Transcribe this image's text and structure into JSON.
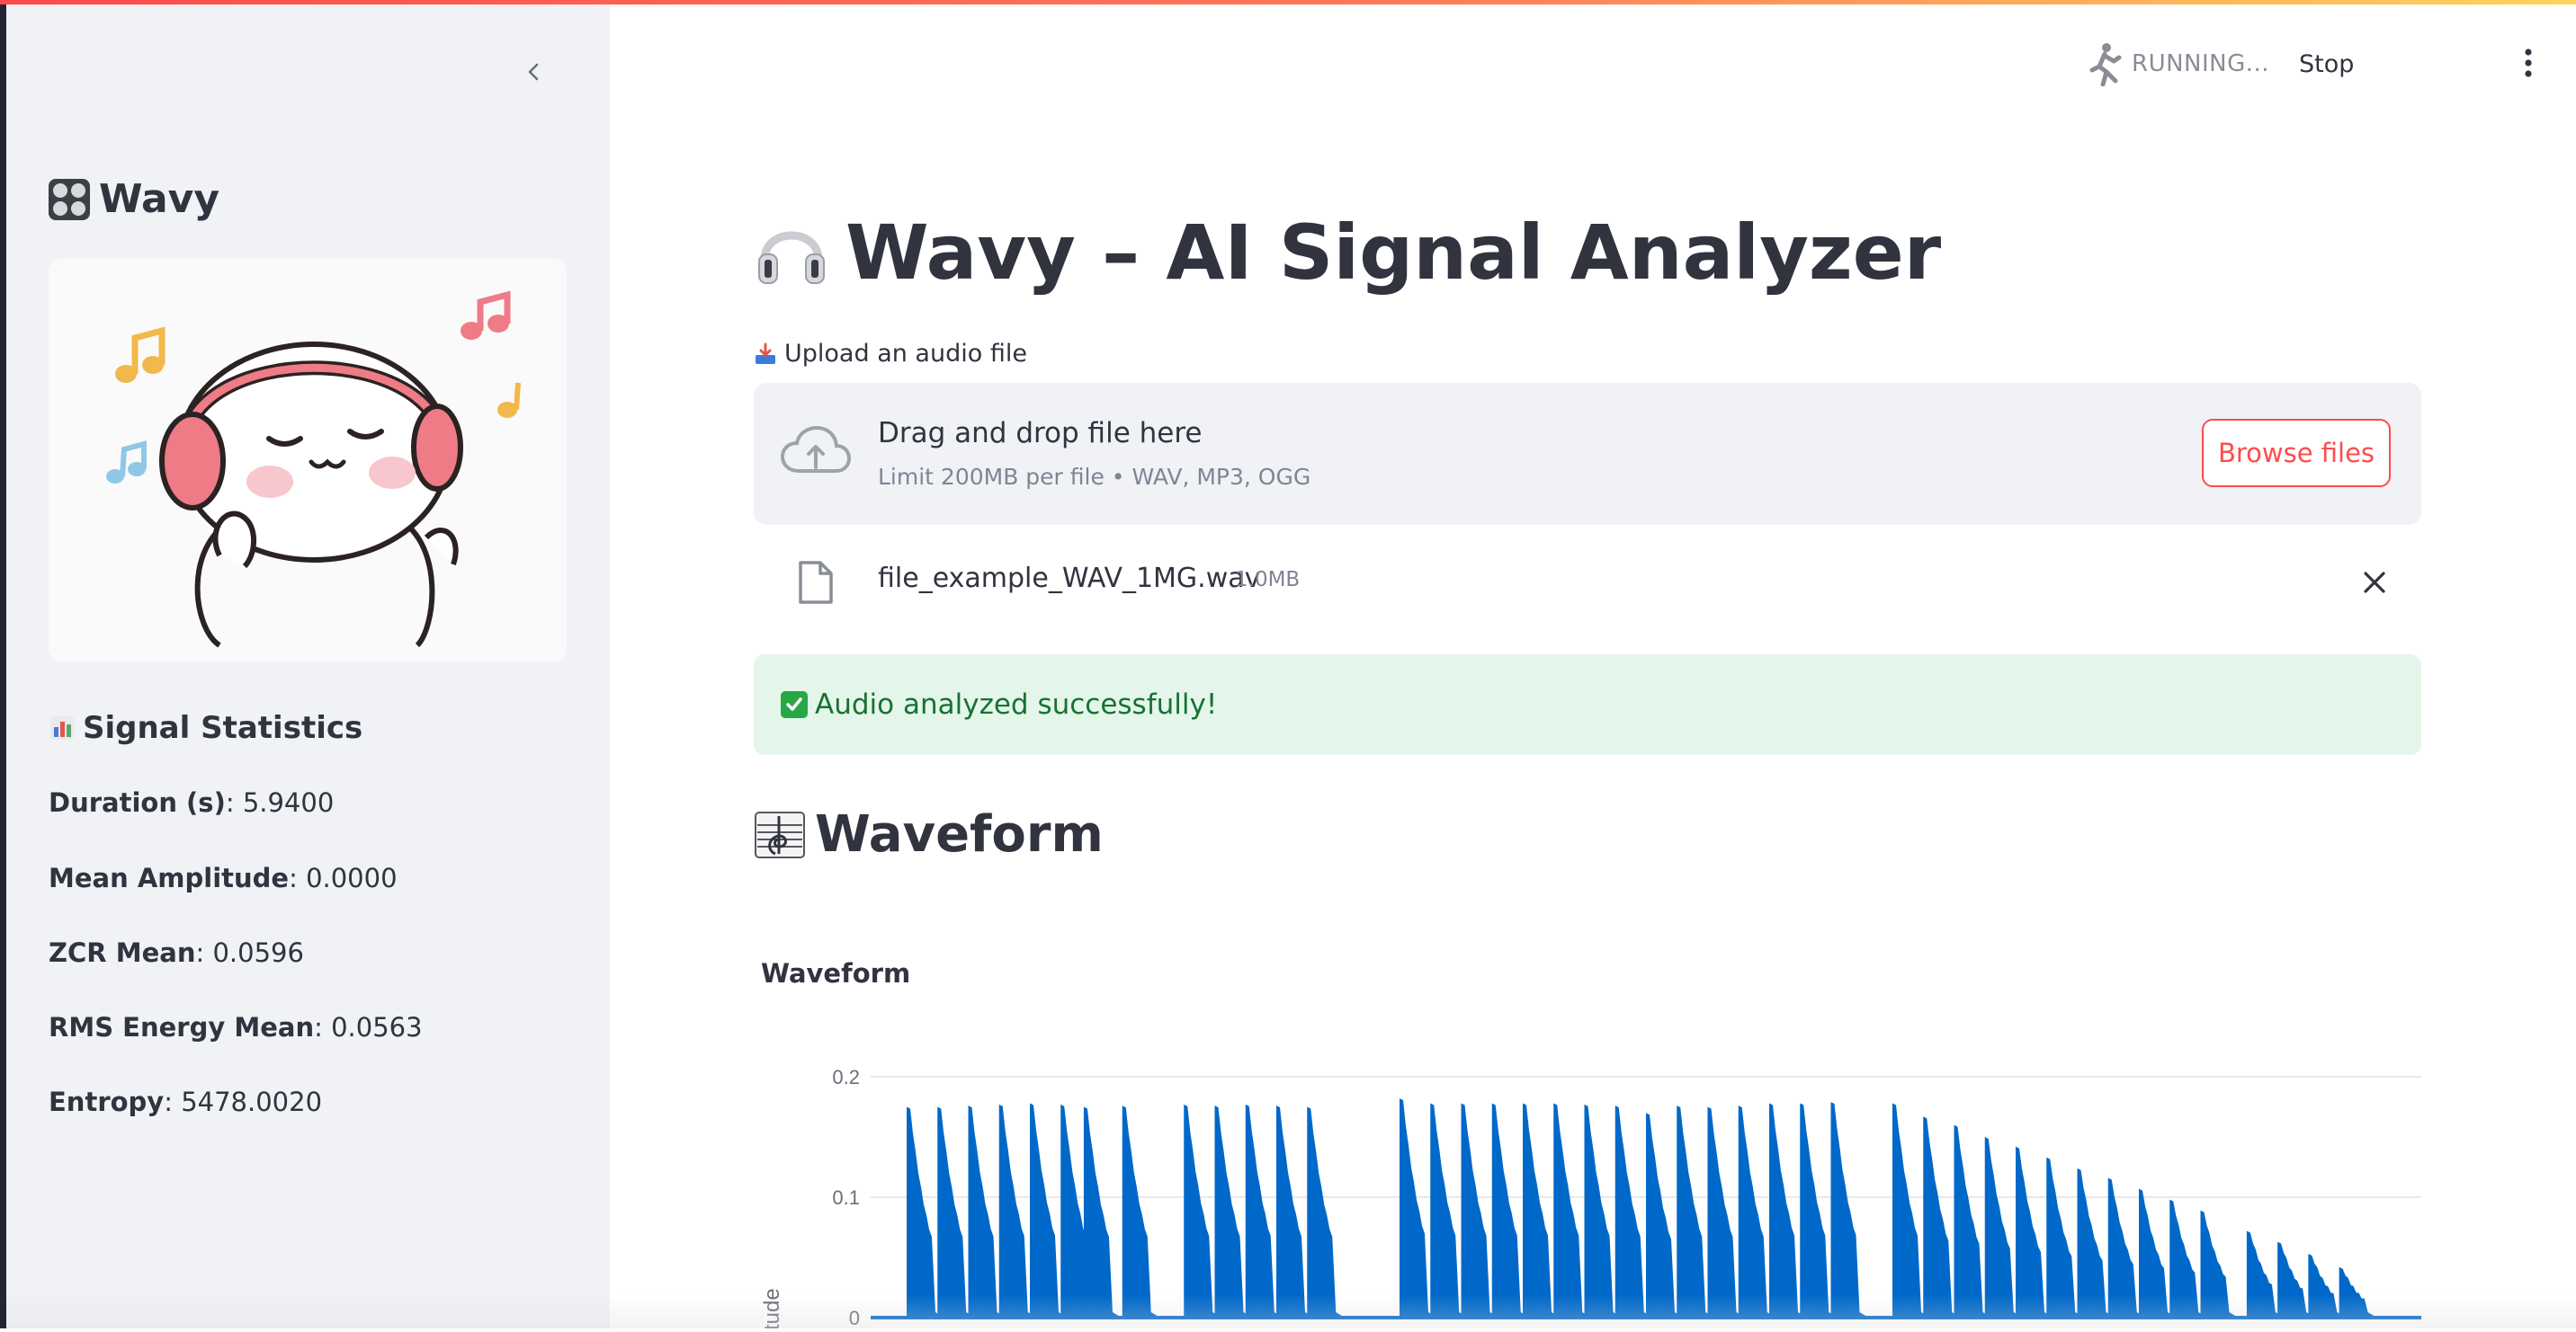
{
  "header": {
    "status": "RUNNING...",
    "stop_label": "Stop"
  },
  "sidebar": {
    "brand": "Wavy",
    "stats_title": "Signal Statistics",
    "stats": [
      {
        "label": "Duration (s)",
        "value": ": 5.9400"
      },
      {
        "label": "Mean Amplitude",
        "value": ": 0.0000"
      },
      {
        "label": "ZCR Mean",
        "value": ": 0.0596"
      },
      {
        "label": "RMS Energy Mean",
        "value": ": 0.0563"
      },
      {
        "label": "Entropy",
        "value": ": 5478.0020"
      }
    ]
  },
  "main": {
    "title": "Wavy – AI Signal Analyzer",
    "upload_label": "Upload an audio file",
    "dropzone": {
      "title": "Drag and drop file here",
      "limit": "Limit 200MB per file • WAV, MP3, OGG",
      "browse_label": "Browse files"
    },
    "file": {
      "name": "file_example_WAV_1MG.wav",
      "size": "1.0MB"
    },
    "success": "Audio analyzed successfully!",
    "section_title": "Waveform"
  },
  "chart_data": {
    "type": "area",
    "title": "Waveform",
    "ylabel": "Amplitude",
    "ylim": [
      0,
      0.2
    ],
    "yticks": [
      "0.2",
      "0.1",
      "0"
    ],
    "series_color": "#0068c9",
    "bursts": [
      {
        "t": 0.0,
        "a": 0.175
      },
      {
        "t": 0.04,
        "a": 0.175
      },
      {
        "t": 0.08,
        "a": 0.176
      },
      {
        "t": 0.12,
        "a": 0.177
      },
      {
        "t": 0.16,
        "a": 0.178
      },
      {
        "t": 0.2,
        "a": 0.177
      },
      {
        "t": 0.23,
        "a": 0.175
      },
      {
        "t": 0.28,
        "a": 0.176
      },
      {
        "t": 0.36,
        "a": 0.177
      },
      {
        "t": 0.4,
        "a": 0.176
      },
      {
        "t": 0.44,
        "a": 0.177
      },
      {
        "t": 0.48,
        "a": 0.176
      },
      {
        "t": 0.52,
        "a": 0.175
      },
      {
        "t": 0.64,
        "a": 0.182
      },
      {
        "t": 0.68,
        "a": 0.178
      },
      {
        "t": 0.72,
        "a": 0.178
      },
      {
        "t": 0.76,
        "a": 0.178
      },
      {
        "t": 0.8,
        "a": 0.178
      },
      {
        "t": 0.84,
        "a": 0.178
      },
      {
        "t": 0.88,
        "a": 0.177
      },
      {
        "t": 0.92,
        "a": 0.176
      },
      {
        "t": 0.96,
        "a": 0.17
      },
      {
        "t": 1.0,
        "a": 0.176
      },
      {
        "t": 1.04,
        "a": 0.175
      },
      {
        "t": 1.08,
        "a": 0.176
      },
      {
        "t": 1.12,
        "a": 0.178
      },
      {
        "t": 1.16,
        "a": 0.178
      },
      {
        "t": 1.2,
        "a": 0.179
      },
      {
        "t": 1.28,
        "a": 0.178
      },
      {
        "t": 1.32,
        "a": 0.167
      },
      {
        "t": 1.36,
        "a": 0.16
      },
      {
        "t": 1.4,
        "a": 0.15
      },
      {
        "t": 1.44,
        "a": 0.142
      },
      {
        "t": 1.48,
        "a": 0.133
      },
      {
        "t": 1.52,
        "a": 0.124
      },
      {
        "t": 1.56,
        "a": 0.116
      },
      {
        "t": 1.6,
        "a": 0.107
      },
      {
        "t": 1.64,
        "a": 0.098
      },
      {
        "t": 1.68,
        "a": 0.089
      },
      {
        "t": 1.74,
        "a": 0.072
      },
      {
        "t": 1.78,
        "a": 0.063
      },
      {
        "t": 1.82,
        "a": 0.053
      },
      {
        "t": 1.86,
        "a": 0.042
      }
    ]
  }
}
